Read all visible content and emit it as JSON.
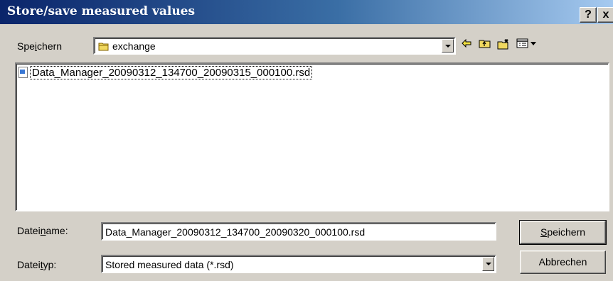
{
  "window": {
    "title": "Store/save measured values",
    "help_glyph": "?",
    "close_glyph": "x"
  },
  "lookin": {
    "label_prefix": "Spe",
    "label_accel": "i",
    "label_suffix": "chern",
    "folder": "exchange"
  },
  "toolbar": {
    "back_icon": "back-arrow-icon",
    "up_icon": "folder-up-icon",
    "new_folder_icon": "new-folder-icon",
    "view_icon": "view-menu-icon"
  },
  "files": [
    {
      "name": "Data_Manager_20090312_134700_20090315_000100.rsd"
    }
  ],
  "filename": {
    "label_prefix": "Datei",
    "label_accel": "n",
    "label_suffix": "ame:",
    "value": "Data_Manager_20090312_134700_20090320_000100.rsd"
  },
  "filetype": {
    "label_prefix": "Datei",
    "label_accel": "t",
    "label_suffix": "yp:",
    "value": "Stored measured data (*.rsd)"
  },
  "buttons": {
    "save_accel": "S",
    "save_rest": "peichern",
    "cancel": "Abbrechen"
  },
  "colors": {
    "title_start": "#0a246a",
    "title_end": "#a6caf0",
    "face": "#d4d0c8"
  }
}
